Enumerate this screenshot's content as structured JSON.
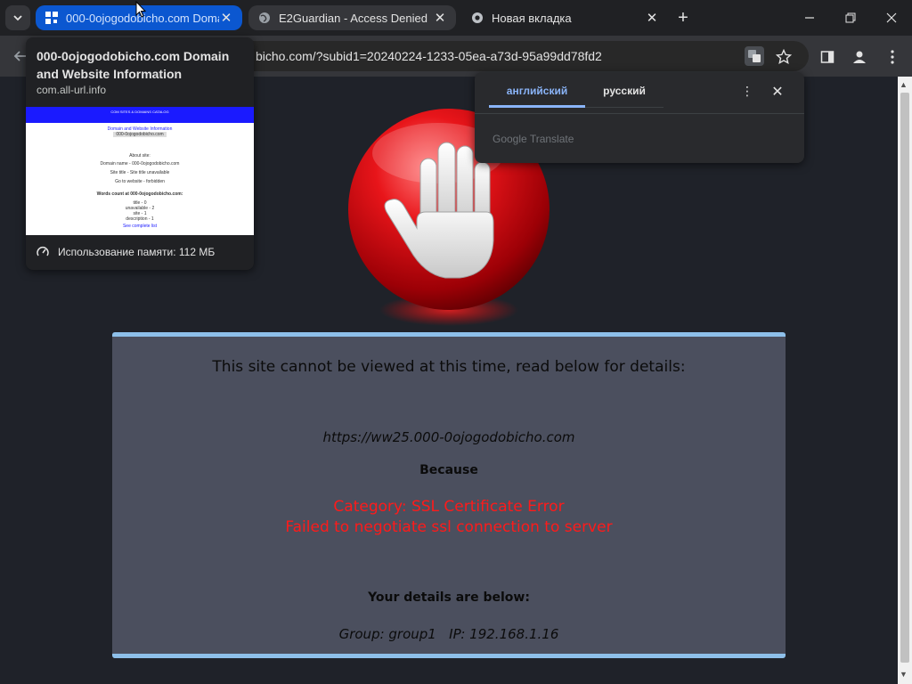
{
  "browser": {
    "tabs": [
      {
        "title": "000-0ojogodobicho.com Doma",
        "active": true
      },
      {
        "title": "E2Guardian - Access Denied",
        "active": false
      },
      {
        "title": "Новая вкладка",
        "active": false
      }
    ],
    "url": "bicho.com/?subid1=20240224-1233-05ea-a73d-95a99dd78fd2"
  },
  "hover_card": {
    "title": "000-0ojogodobicho.com Domain and Website Information",
    "domain": "com.all-url.info",
    "thumbnail_lines": [
      "COM SITES & DOMAINS CATALOG",
      "Domain and Website Information",
      "000-0ojogodobicho.com",
      "About site:",
      "Domain name - 000-0ojogodobicho.com",
      "Site title - Site title unavailable",
      "Go to website - forbidden",
      "Words count at 000-0ojogodobicho.com:",
      "title - 0",
      "unavailable - 2",
      "site - 1",
      "description - 1",
      "See complete list"
    ],
    "memory": "Использование памяти: 112 МБ"
  },
  "translate": {
    "tab_source": "английский",
    "tab_target": "русский",
    "footer": "Google Translate"
  },
  "page": {
    "heading": "This site cannot be viewed at this time, read below for details:",
    "blocked_url": "https://ww25.000-0ojogodobicho.com",
    "because": "Because",
    "category": "Category: SSL Certificate Error",
    "reason": "Failed to negotiate ssl connection to server",
    "details_heading": "Your details are below:",
    "group_info": "Group: group1   IP: 192.168.1.16"
  },
  "colors": {
    "active_tab": "#0b57d0",
    "panel": "#4b4f5e",
    "panel_border": "#8ec0ea",
    "error_text": "#ff1a1a"
  }
}
